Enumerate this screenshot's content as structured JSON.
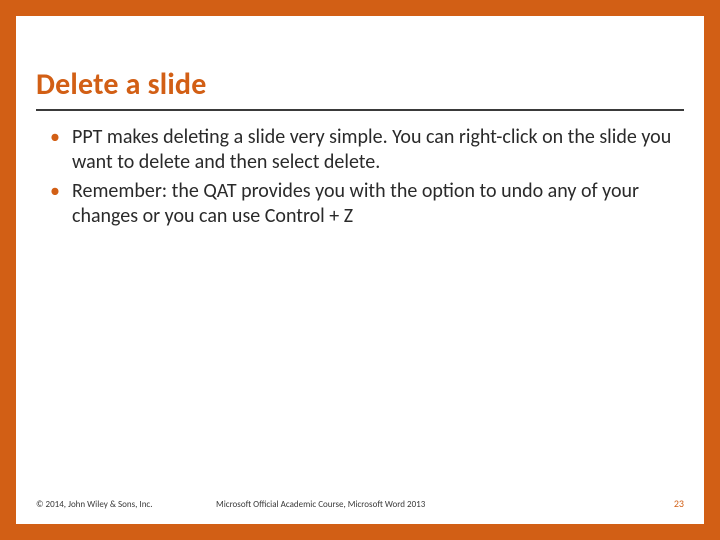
{
  "title": "Delete a slide",
  "bullets": [
    "PPT makes deleting a slide very simple.  You can right-click on the slide you want to delete and then select delete.",
    "Remember:  the QAT provides you with the option to undo any of your changes or you can use Control + Z"
  ],
  "footer": {
    "copyright": "© 2014, John Wiley & Sons, Inc.",
    "course": "Microsoft Official Academic Course, Microsoft Word 2013",
    "page": "23"
  }
}
